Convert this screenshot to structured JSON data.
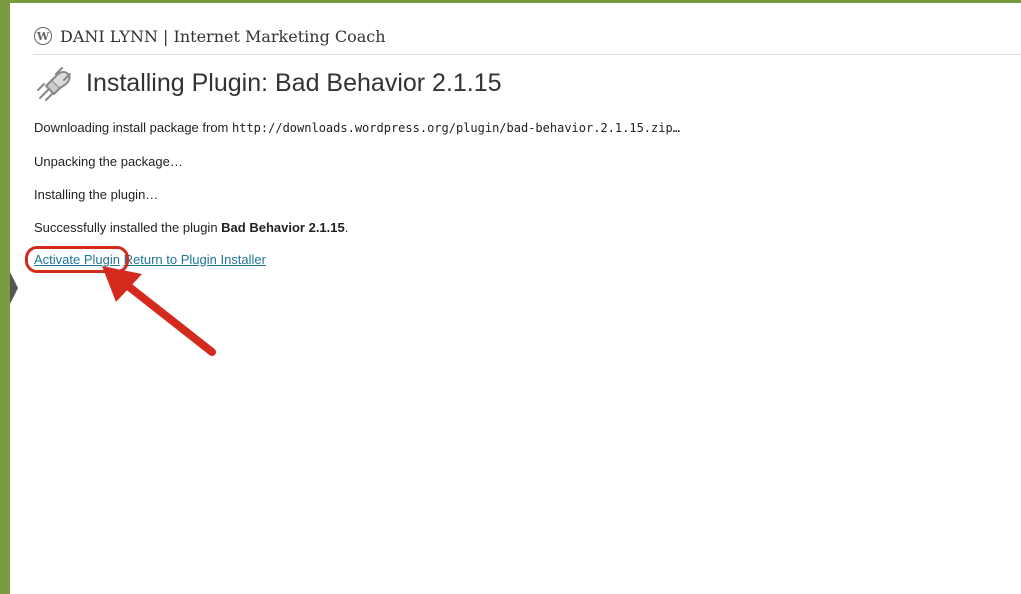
{
  "site": {
    "logo_glyph": "W",
    "title": "DANI LYNN | Internet Marketing Coach"
  },
  "page": {
    "title": "Installing Plugin: Bad Behavior 2.1.15",
    "icon": "plugin-icon"
  },
  "log": {
    "download_prefix": "Downloading install package from ",
    "download_url": "http://downloads.wordpress.org/plugin/bad-behavior.2.1.15.zip…",
    "unpacking": "Unpacking the package…",
    "installing": "Installing the plugin…",
    "success_prefix": "Successfully installed the plugin ",
    "success_plugin": "Bad Behavior 2.1.15",
    "success_suffix": "."
  },
  "actions": {
    "activate_label": "Activate Plugin",
    "return_label": "Return to Plugin Installer"
  },
  "colors": {
    "frame": "#7a9a3f",
    "link": "#21759b",
    "annotation": "#d42a1e"
  }
}
